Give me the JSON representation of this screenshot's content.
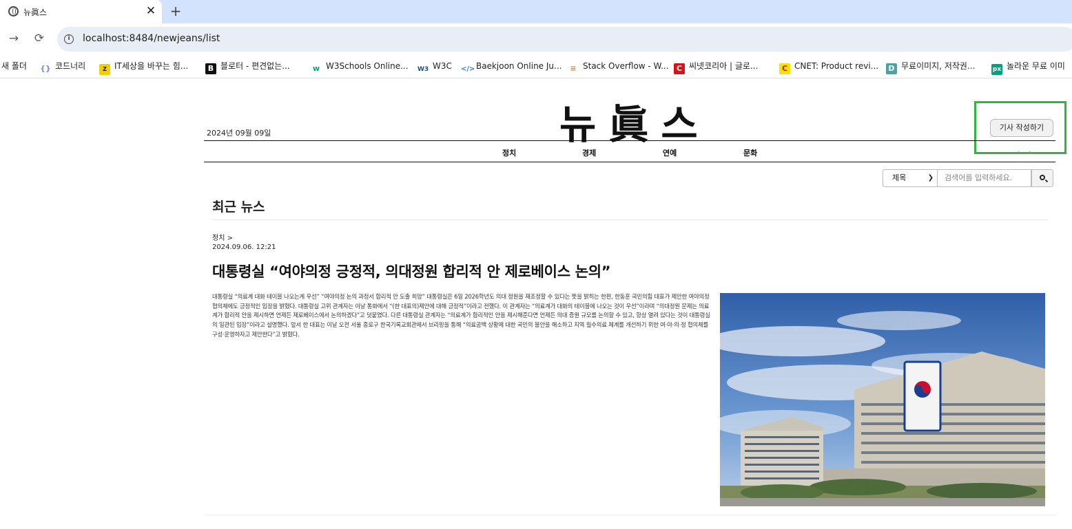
{
  "browser": {
    "tab_title": "뉴眞스",
    "url": "localhost:8484/newjeans/list",
    "close_glyph": "✕",
    "newtab_glyph": "+",
    "bookmarks": [
      {
        "label": "새 폴더",
        "icon": "folder-icon"
      },
      {
        "label": "코드너리",
        "icon": "braces-icon"
      },
      {
        "label": "IT세상을 바꾸는 힘...",
        "icon": "zdnet-icon"
      },
      {
        "label": "블로터 - 편견없는...",
        "icon": "bloter-icon"
      },
      {
        "label": "W3Schools Online...",
        "icon": "w3schools-icon"
      },
      {
        "label": "W3C",
        "icon": "w3c-icon"
      },
      {
        "label": "Baekjoon Online Ju...",
        "icon": "code-icon"
      },
      {
        "label": "Stack Overflow - W...",
        "icon": "stackoverflow-icon"
      },
      {
        "label": "씨넷코리아 | 글로...",
        "icon": "cnet-korea-icon"
      },
      {
        "label": "CNET: Product revi...",
        "icon": "cnet-icon"
      },
      {
        "label": "무료이미지, 저작권...",
        "icon": "image-icon"
      },
      {
        "label": "놀라운 무료 이미",
        "icon": "pexels-icon"
      }
    ]
  },
  "header": {
    "date": "2024년 09월 09일",
    "logo": "뉴眞스",
    "write_button": "기사 작성하기",
    "categories": [
      "정치",
      "경제",
      "연예",
      "문화"
    ]
  },
  "search": {
    "selected_option": "제목",
    "placeholder": "검색어를 입력하세요."
  },
  "main": {
    "section_title": "최근 뉴스",
    "article": {
      "category": "정치 >",
      "datetime": "2024.09.06. 12:21",
      "headline": "대통령실 “여야의정 긍정적, 의대정원 합리적 안 제로베이스 논의”",
      "body": "대통령실 “의료계 대화 테이블 나오는게 우선” “여야의정 논의 과정서 합리적 안 도출 희망” 대통령실은 6일 2026학년도 의대 정원을 재조정할 수 있다는 뜻을 밝히는 한편, 한동훈 국민의힘 대표가 제안한 여야의정 협의체에도 긍정적인 입장을 밝혔다. 대통령실 고위 관계자는 이날 통화에서 “(한 대표의)제안에 대해 긍정적”이라고 전했다. 이 관계자는 “의료계가 대화의 테이블에 나오는 것이 우선”이라며 “의대정원 문제는 의료계가 합리적 안을 제시하면 언제든 제로베이스에서 논의하겠다”고 덧붙였다. 다른 대통령실 관계자는 “의료계가 합리적인 안을 제시해준다면 언제든 의대 증원 규모를 논의할 수 있고, 항상 열려 있다는 것이 대통령실의 일관된 입장”이라고 설명했다. 앞서 한 대표는 이날 오전 서울 종로구 한국기록교회관에서 브리핑을 통해 “의료공백 상황에 대한 국민의 불안을 해소하고 지역 필수의료 체계를 개선하기 위한 여·야·의·정 협의체를 구성·운영하자고 제안한다”고 밝혔다."
    }
  },
  "colors": {
    "tabstrip": "#d3e3fd",
    "omnibox": "#e9eef6",
    "highlight": "#2db83d"
  }
}
